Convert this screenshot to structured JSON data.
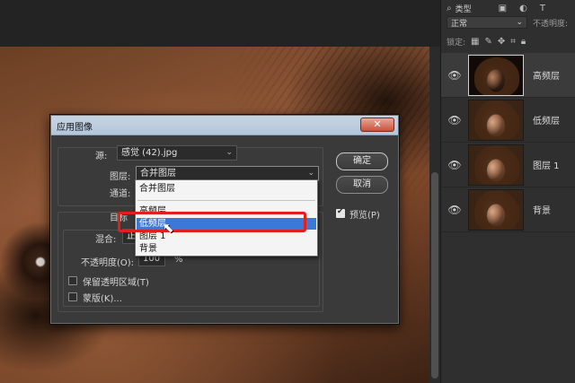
{
  "layers_panel": {
    "kind_filter": "类型",
    "blend_mode": "正常",
    "opacity_label": "不透明度:",
    "lock_label": "锁定:",
    "layers": [
      {
        "name": "高频层",
        "selected": true
      },
      {
        "name": "低频层",
        "selected": false
      },
      {
        "name": "图层 1",
        "selected": false
      },
      {
        "name": "背景",
        "selected": false
      }
    ]
  },
  "dialog": {
    "title": "应用图像",
    "close": "✕",
    "source_label": "源:",
    "source_value": "感觉 (42).jpg",
    "layer_label": "图层:",
    "layer_value": "合并图层",
    "channel_label": "通道:",
    "target_label_partial": "目标",
    "blend_label": "混合:",
    "blend_value_partial": "正",
    "opacity_label": "不透明度(O):",
    "opacity_value": "100",
    "opacity_unit": "%",
    "preserve_transparency": "保留透明区域(T)",
    "mask": "蒙版(K)...",
    "ok": "确定",
    "cancel": "取消",
    "preview": "预览(P)",
    "preview_checked": true,
    "dropdown_items": [
      "合并图层",
      "高频层",
      "低频层",
      "图层 1",
      "背景"
    ],
    "dropdown_selected": "低频层"
  },
  "colors": {
    "dropdown_highlight": "#3c78d8",
    "annotation_box": "#e21f1f"
  }
}
